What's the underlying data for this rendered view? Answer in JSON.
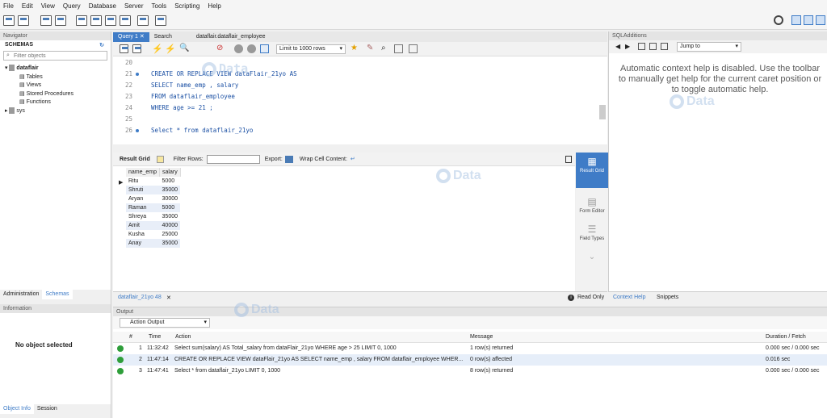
{
  "menu": [
    "File",
    "Edit",
    "View",
    "Query",
    "Database",
    "Server",
    "Tools",
    "Scripting",
    "Help"
  ],
  "navigator": {
    "title": "Navigator",
    "schemas_label": "SCHEMAS",
    "filter_placeholder": "Filter objects",
    "tree": {
      "db": "dataflair",
      "children": [
        "Tables",
        "Views",
        "Stored Procedures",
        "Functions"
      ],
      "other": "sys"
    },
    "bottom_tabs": [
      "Administration",
      "Schemas"
    ]
  },
  "information": {
    "title": "Information",
    "text": "No object selected",
    "tabs": [
      "Object Info",
      "Session"
    ]
  },
  "editor": {
    "tabs": [
      "Query 1",
      "Search",
      "dataflair.dataflair_employee"
    ],
    "limit": "Limit to 1000 rows",
    "lines": [
      {
        "n": "20",
        "t": ""
      },
      {
        "n": "21",
        "t": "CREATE OR REPLACE VIEW dataFlair_21yo AS"
      },
      {
        "n": "22",
        "t": "SELECT name_emp , salary"
      },
      {
        "n": "23",
        "t": "FROM dataflair_employee"
      },
      {
        "n": "24",
        "t": "WHERE age >= 21 ;"
      },
      {
        "n": "25",
        "t": ""
      },
      {
        "n": "26",
        "t": "Select * from dataflair_21yo"
      }
    ]
  },
  "result": {
    "grid_label": "Result Grid",
    "filter_label": "Filter Rows:",
    "export_label": "Export:",
    "wrap_label": "Wrap Cell Content:",
    "columns": [
      "name_emp",
      "salary"
    ],
    "rows": [
      [
        "Ritu",
        "5000"
      ],
      [
        "Shruti",
        "35000"
      ],
      [
        "Aryan",
        "30000"
      ],
      [
        "Raman",
        "5000"
      ],
      [
        "Shreya",
        "35000"
      ],
      [
        "Amit",
        "40000"
      ],
      [
        "Kusha",
        "25000"
      ],
      [
        "Anay",
        "35000"
      ]
    ],
    "side": [
      "Result Grid",
      "Form Editor",
      "Field Types"
    ],
    "tab": "dataflair_21yo 48",
    "status": "Read Only"
  },
  "sql_additions": {
    "title": "SQLAdditions",
    "jump": "Jump to",
    "help": "Automatic context help is disabled. Use the toolbar to manually get help for the current caret position or to toggle automatic help.",
    "tabs": [
      "Context Help",
      "Snippets"
    ]
  },
  "output": {
    "title": "Output",
    "mode": "Action Output",
    "headers": [
      "#",
      "Time",
      "Action",
      "Message",
      "Duration / Fetch"
    ],
    "rows": [
      {
        "n": "1",
        "time": "11:32:42",
        "action": "Select sum(salary) AS Total_salary from dataFlair_21yo WHERE age > 25 LIMIT 0, 1000",
        "msg": "1 row(s) returned",
        "dur": "0.000 sec / 0.000 sec"
      },
      {
        "n": "2",
        "time": "11:47:14",
        "action": "CREATE OR REPLACE VIEW dataFlair_21yo AS SELECT name_emp , salary FROM dataflair_employee WHER...",
        "msg": "0 row(s) affected",
        "dur": "0.016 sec"
      },
      {
        "n": "3",
        "time": "11:47:41",
        "action": "Select * from dataflair_21yo LIMIT 0, 1000",
        "msg": "8 row(s) returned",
        "dur": "0.000 sec / 0.000 sec"
      }
    ]
  },
  "colors": {
    "accent": "#3f7cc7",
    "ok": "#2e9e3a"
  }
}
